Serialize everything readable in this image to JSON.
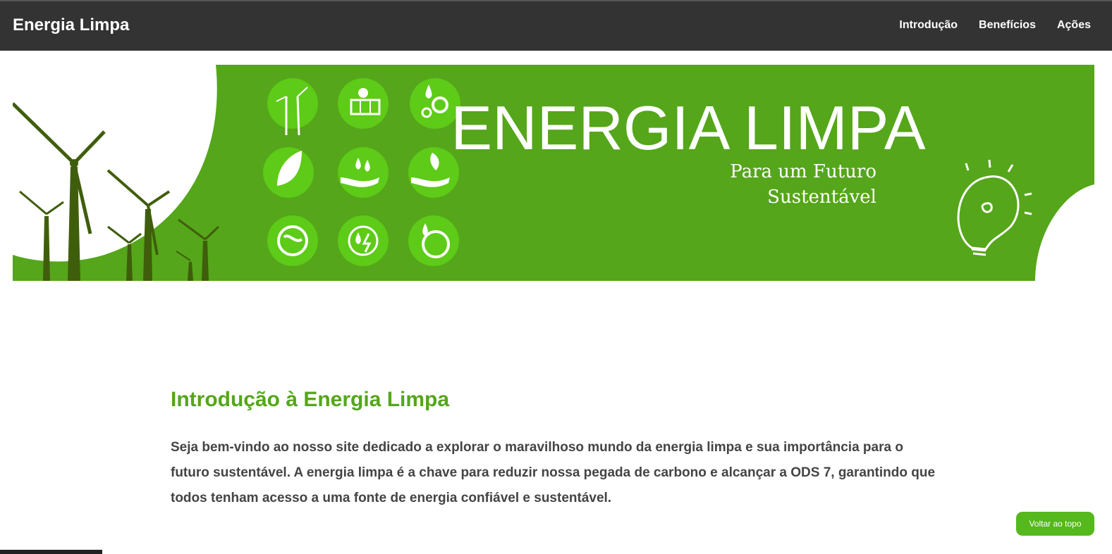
{
  "header": {
    "brand": "Energia Limpa",
    "nav": [
      "Introdução",
      "Benefícios",
      "Ações"
    ]
  },
  "banner": {
    "title": "ENERGIA LIMPA",
    "subtitle_line1": "Para um Futuro",
    "subtitle_line2": "Sustentável",
    "icons": [
      "wind-turbine-icon",
      "solar-panel-icon",
      "water-gear-icon",
      "leaf-icon",
      "hand-water-icon",
      "hand-leaves-icon",
      "globe-recycle-icon",
      "water-energy-cycle-icon",
      "globe-water-icon"
    ],
    "colors": {
      "green": "#55a61a",
      "dark_green": "#3f6b10",
      "icon_circle": "#5dcb17"
    }
  },
  "intro": {
    "heading": "Introdução à Energia Limpa",
    "paragraph": "Seja bem-vindo ao nosso site dedicado a explorar o maravilhoso mundo da energia limpa e sua importância para o futuro sustentável. A energia limpa é a chave para reduzir nossa pegada de carbono e alcançar a ODS 7, garantindo que todos tenham acesso a uma fonte de energia confiável e sustentável."
  },
  "back_to_top": "Voltar ao topo"
}
